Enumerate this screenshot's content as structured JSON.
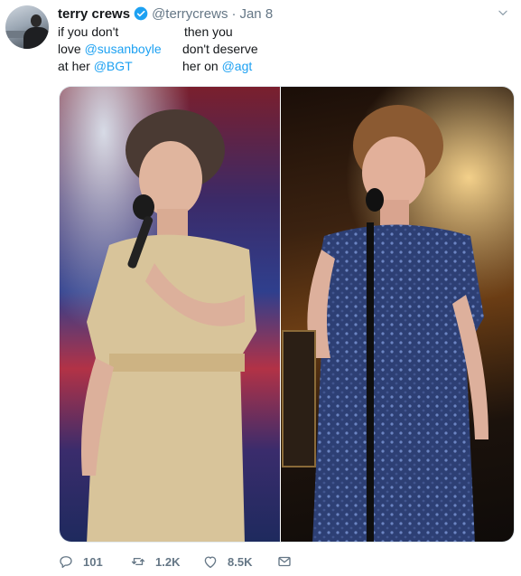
{
  "tweet": {
    "author": {
      "name": "terry crews",
      "handle": "@terrycrews",
      "separator": "·",
      "date": "Jan 8"
    },
    "text": {
      "col1": [
        {
          "text": "if you don't"
        },
        {
          "text": "love ",
          "mention": "@susanboyle"
        },
        {
          "text": "at her ",
          "mention": "@BGT"
        }
      ],
      "col2": [
        {
          "text": "then you"
        },
        {
          "text": "don't deserve"
        },
        {
          "text": "her on ",
          "mention": "@agt"
        }
      ]
    },
    "actions": {
      "reply_count": "101",
      "retweet_count": "1.2K",
      "like_count": "8.5K"
    },
    "colors": {
      "link": "#1da1f2",
      "muted": "#657786",
      "verified": "#1da1f2"
    }
  }
}
